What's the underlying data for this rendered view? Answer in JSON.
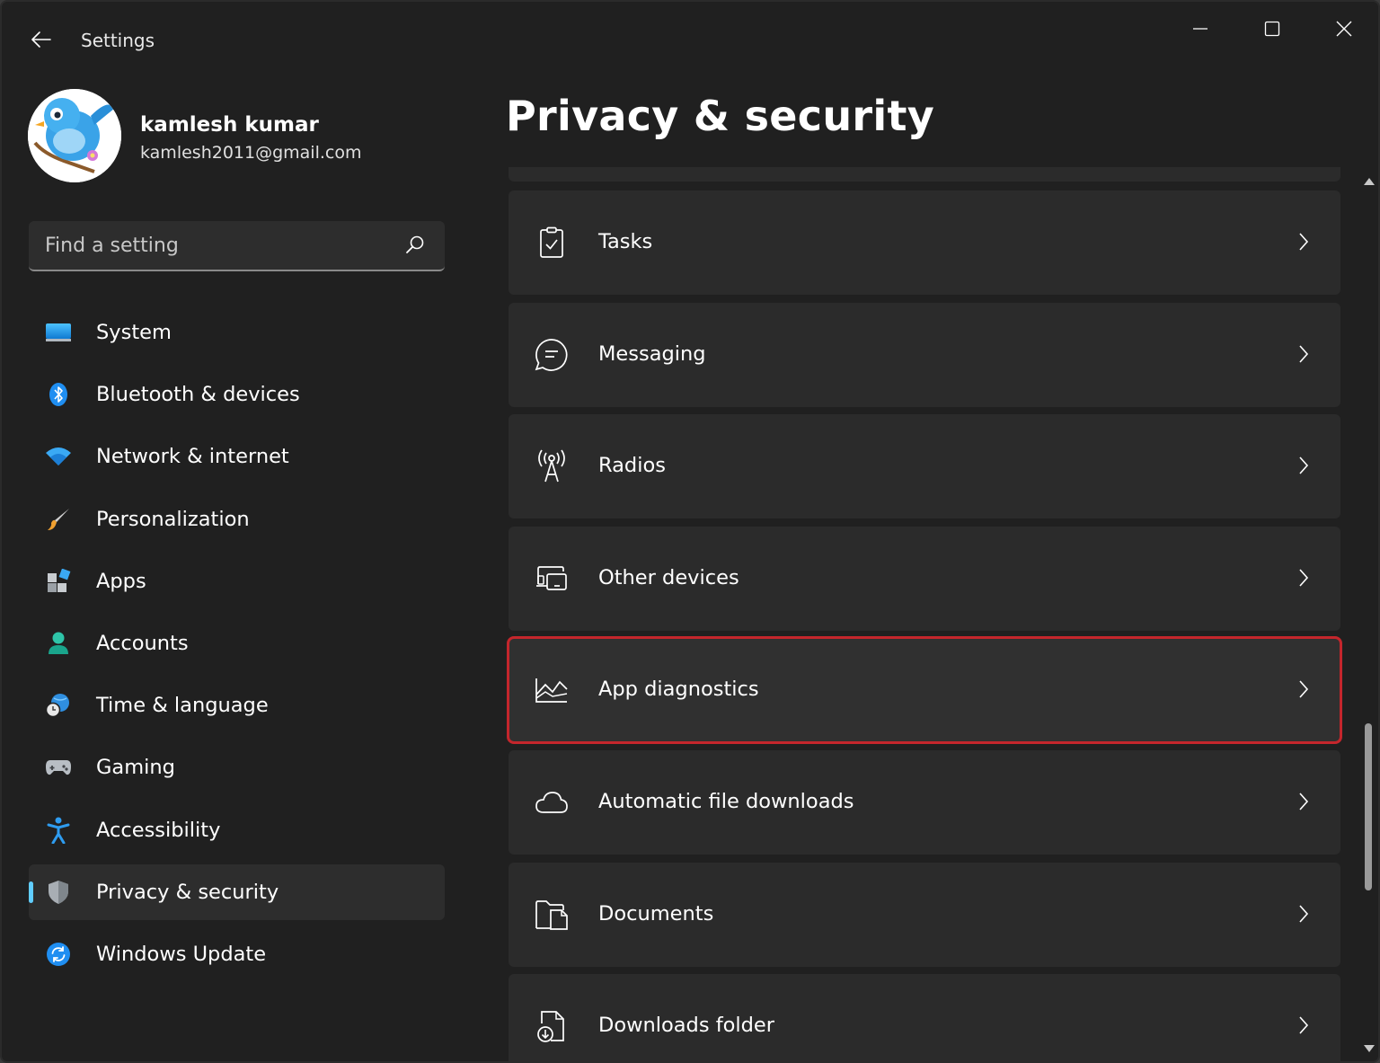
{
  "window": {
    "title": "Settings"
  },
  "profile": {
    "name": "kamlesh kumar",
    "email": "kamlesh2011@gmail.com"
  },
  "search": {
    "placeholder": "Find a setting",
    "value": ""
  },
  "sidebar": {
    "items": [
      {
        "label": "System",
        "icon": "system-icon",
        "active": false
      },
      {
        "label": "Bluetooth & devices",
        "icon": "bluetooth-icon",
        "active": false
      },
      {
        "label": "Network & internet",
        "icon": "wifi-icon",
        "active": false
      },
      {
        "label": "Personalization",
        "icon": "brush-icon",
        "active": false
      },
      {
        "label": "Apps",
        "icon": "apps-icon",
        "active": false
      },
      {
        "label": "Accounts",
        "icon": "person-icon",
        "active": false
      },
      {
        "label": "Time & language",
        "icon": "globe-clock-icon",
        "active": false
      },
      {
        "label": "Gaming",
        "icon": "gamepad-icon",
        "active": false
      },
      {
        "label": "Accessibility",
        "icon": "accessibility-icon",
        "active": false
      },
      {
        "label": "Privacy & security",
        "icon": "shield-icon",
        "active": true
      },
      {
        "label": "Windows Update",
        "icon": "update-icon",
        "active": false
      }
    ]
  },
  "main": {
    "title": "Privacy & security",
    "items": [
      {
        "label": "Tasks",
        "icon": "clipboard-check-icon",
        "highlighted": false
      },
      {
        "label": "Messaging",
        "icon": "chat-icon",
        "highlighted": false
      },
      {
        "label": "Radios",
        "icon": "radio-tower-icon",
        "highlighted": false
      },
      {
        "label": "Other devices",
        "icon": "devices-icon",
        "highlighted": false
      },
      {
        "label": "App diagnostics",
        "icon": "diagnostics-chart-icon",
        "highlighted": true
      },
      {
        "label": "Automatic file downloads",
        "icon": "cloud-icon",
        "highlighted": false
      },
      {
        "label": "Documents",
        "icon": "documents-icon",
        "highlighted": false
      },
      {
        "label": "Downloads folder",
        "icon": "download-file-icon",
        "highlighted": false
      }
    ]
  },
  "colors": {
    "accent": "#60cdff",
    "highlight_border": "#c4262c",
    "background": "#202020",
    "card": "#2b2b2b"
  }
}
